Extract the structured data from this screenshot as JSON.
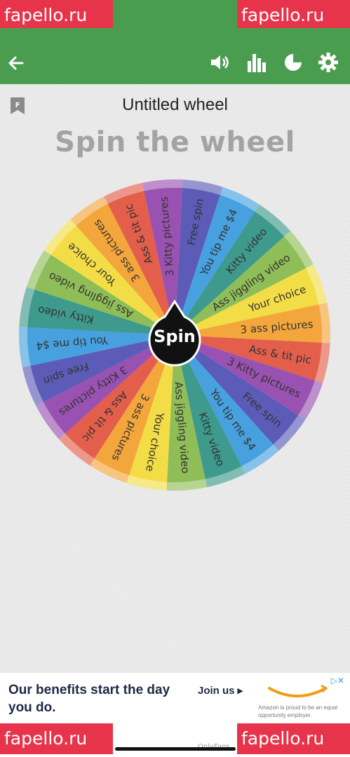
{
  "watermark": {
    "text": "fapello.ru"
  },
  "app_bar": {
    "accent": "#4a9d4f",
    "icons": [
      "back-arrow-icon",
      "volume-icon",
      "bar-chart-icon",
      "pie-chart-icon",
      "gear-icon"
    ]
  },
  "wheel": {
    "title": "Untitled wheel",
    "heading": "Spin the wheel",
    "spin_label": "Spin",
    "segments": [
      {
        "label": "Free spin",
        "color": "#5c5cb8"
      },
      {
        "label": "You tip me $4",
        "color": "#47a1df"
      },
      {
        "label": "Kitty video",
        "color": "#3e9a8c"
      },
      {
        "label": "Ass jiggling video",
        "color": "#8fbd57"
      },
      {
        "label": "Your choice",
        "color": "#f3dd46"
      },
      {
        "label": "3 ass pictures",
        "color": "#f3a63b"
      },
      {
        "label": "Ass & tit pic",
        "color": "#e35f4b"
      },
      {
        "label": "3 Kitty pictures",
        "color": "#9a52b2"
      },
      {
        "label": "Free spin",
        "color": "#5c5cb8"
      },
      {
        "label": "You tip me $4",
        "color": "#47a1df"
      },
      {
        "label": "Kitty video",
        "color": "#3e9a8c"
      },
      {
        "label": "Ass jiggling video",
        "color": "#8fbd57"
      },
      {
        "label": "Your choice",
        "color": "#f3dd46"
      },
      {
        "label": "3 ass pictures",
        "color": "#f3a63b"
      },
      {
        "label": "Ass & tit pic",
        "color": "#e35f4b"
      },
      {
        "label": "3 Kitty pictures",
        "color": "#9a52b2"
      },
      {
        "label": "Free spin",
        "color": "#5c5cb8"
      },
      {
        "label": "You tip me $4",
        "color": "#47a1df"
      },
      {
        "label": "Kitty video",
        "color": "#3e9a8c"
      },
      {
        "label": "Ass jiggling video",
        "color": "#8fbd57"
      },
      {
        "label": "Your choice",
        "color": "#f3dd46"
      },
      {
        "label": "3 ass pictures",
        "color": "#f3a63b"
      },
      {
        "label": "Ass & tit pic",
        "color": "#e35f4b"
      },
      {
        "label": "3 Kitty pictures",
        "color": "#9a52b2"
      }
    ]
  },
  "ad": {
    "headline": "Our benefits start the day you do.",
    "cta": "Join us ▸",
    "disclaimer": "Amazon is proud to be an equal opportunity employer.",
    "choices_icon": "ad-choices-icon"
  },
  "footer": {
    "mark": "OnlyFans"
  }
}
